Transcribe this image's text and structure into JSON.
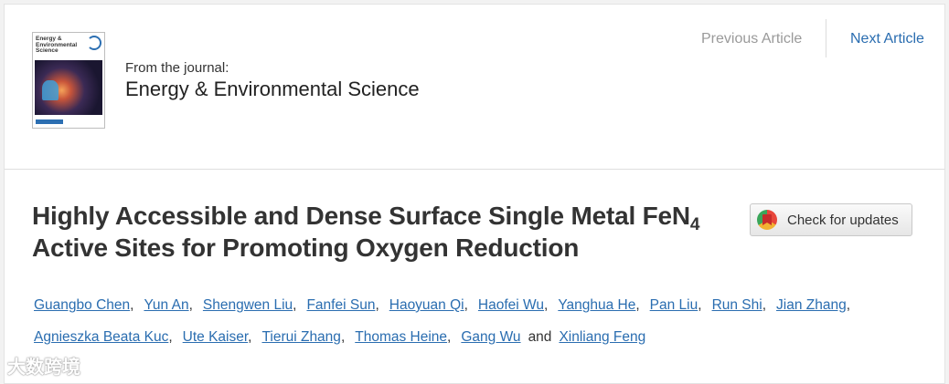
{
  "journal": {
    "from_label": "From the journal:",
    "name": "Energy & Environmental Science",
    "cover_title": "Energy & Environmental Science"
  },
  "nav": {
    "previous": "Previous Article",
    "next": "Next Article"
  },
  "article": {
    "title_part1": "Highly Accessible and Dense Surface Single Metal FeN",
    "title_sub": "4",
    "title_part2": " Active Sites for Promoting Oxygen Reduction"
  },
  "check_updates": "Check for updates",
  "authors": [
    "Guangbo Chen",
    "Yun An",
    "Shengwen Liu",
    "Fanfei Sun",
    "Haoyuan Qi",
    "Haofei Wu",
    "Yanghua He",
    "Pan Liu",
    "Run Shi",
    "Jian Zhang",
    "Agnieszka Beata Kuc",
    "Ute Kaiser",
    "Tierui Zhang",
    "Thomas Heine",
    "Gang Wu",
    "Xinliang Feng"
  ],
  "authors_conjunction": "and",
  "watermark": "大数跨境",
  "colors": {
    "link": "#2a6db0",
    "muted": "#9a9a9a",
    "title": "#333333"
  }
}
